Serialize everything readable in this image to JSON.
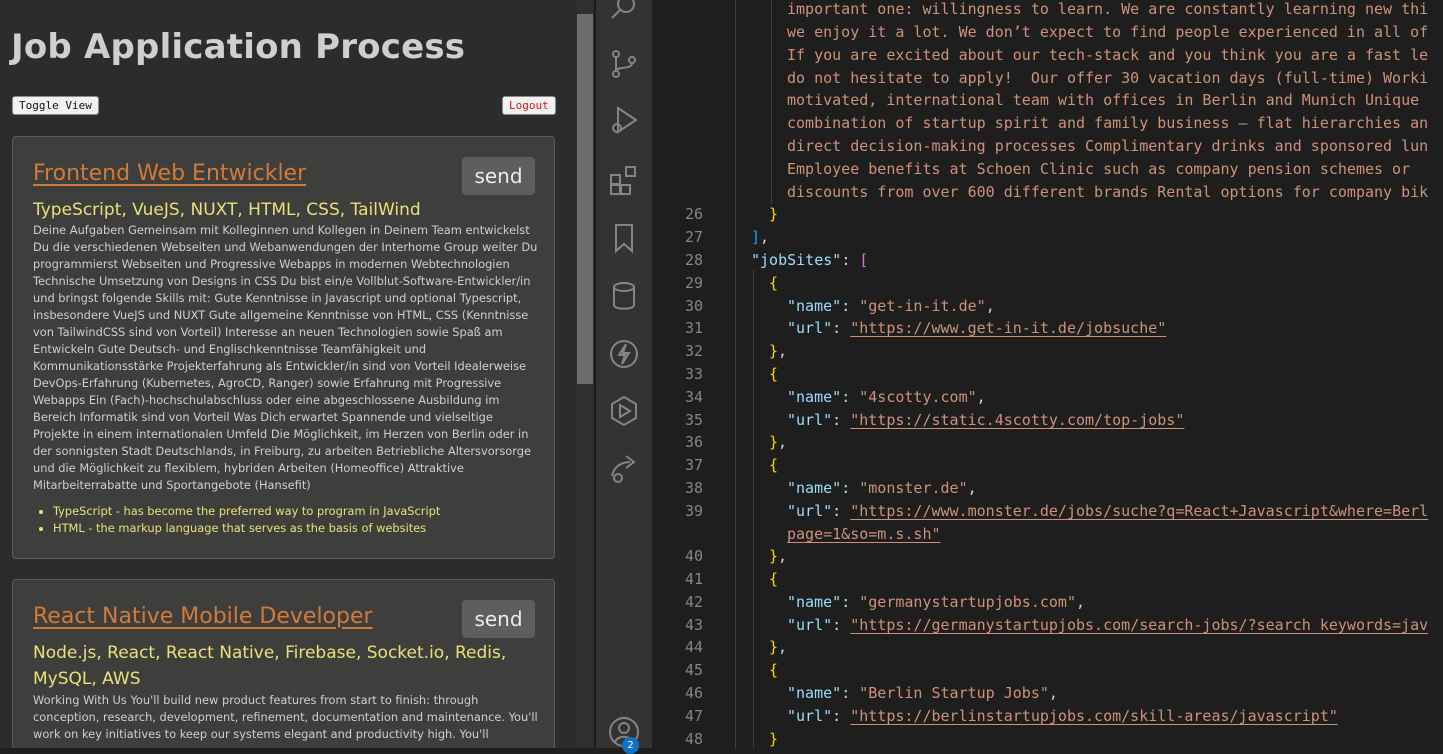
{
  "app": {
    "title": "Job Application Process",
    "toggle_label": "Toggle View",
    "logout_label": "Logout",
    "send_label": "send",
    "jobs": [
      {
        "title": "Frontend Web Entwickler",
        "stack": "TypeScript, VueJS, NUXT, HTML, CSS, TailWind",
        "description": "Deine Aufgaben Gemeinsam mit Kolleginnen und Kollegen in Deinem Team entwickelst Du die verschiedenen Webseiten und Webanwendungen der Interhome Group weiter Du programmierst Webseiten und Progressive Webapps in modernen Webtechnologien Technische Umsetzung von Designs in CSS Du bist ein/e Vollblut-Software-Entwickler/in und bringst folgende Skills mit: Gute Kenntnisse in Javascript und optional Typescript, insbesondere VueJS und NUXT Gute allgemeine Kenntnisse von HTML, CSS (Kenntnisse von TailwindCSS sind von Vorteil) Interesse an neuen Technologien sowie Spaß am Entwickeln Gute Deutsch- und Englischkenntnisse Teamfähigkeit und Kommunikationsstärke Projekterfahrung als Entwickler/in sind von Vorteil Idealerweise DevOps-Erfahrung (Kubernetes, AgroCD, Ranger) sowie Erfahrung mit Progressive Webapps Ein (Fach)-hochschulabschluss oder eine abgeschlossene Ausbildung im Bereich Informatik sind von Vorteil Was Dich erwartet Spannende und vielseitige Projekte in einem internationalen Umfeld Die Möglichkeit, im Herzen von Berlin oder in der sonnigsten Stadt Deutschlands, in Freiburg, zu arbeiten Betriebliche Altersvorsorge und die Möglichkeit zu flexiblem, hybriden Arbeiten (Homeoffice) Attraktive Mitarbeiterrabatte und Sportangebote (Hansefit)",
        "tech_notes": [
          "TypeScript - has become the preferred way to program in JavaScript",
          "HTML - the markup language that serves as the basis of websites"
        ]
      },
      {
        "title": "React Native Mobile Developer",
        "stack": "Node.js, React, React Native, Firebase, Socket.io, Redis, MySQL, AWS",
        "description": "Working With Us You'll build new product features from start to finish: through conception, research, development, refinement, documentation and maintenance. You'll work on key initiatives to keep our systems elegant and productivity high. You'll"
      }
    ]
  },
  "activity_bar": {
    "icons": [
      "search-icon",
      "source-control-icon",
      "run-debug-icon",
      "extensions-icon",
      "bookmark-icon",
      "database-icon",
      "lightning-icon",
      "deploy-icon",
      "remote-share-icon",
      "account-icon"
    ],
    "badge_count": "2",
    "badge_color": "#0e71c6"
  },
  "editor": {
    "wrapped_text": [
      "important one: willingness to learn. We are constantly learning new thi",
      "we enjoy it a lot. We don’t expect to find people experienced in all of",
      "If you are excited about our tech-stack and you think you are a fast le",
      "do not hesitate to apply!  Our offer 30 vacation days (full-time) Worki",
      "motivated, international team with offices in Berlin and Munich Unique",
      "combination of startup spirit and family business – flat hierarchies an",
      "direct decision-making processes Complimentary drinks and sponsored lun",
      "Employee benefits at Schoen Clinic such as company pension schemes or",
      "discounts from over 600 different brands Rental options for company bik"
    ],
    "line_numbers": [
      "26",
      "27",
      "28",
      "29",
      "30",
      "31",
      "32",
      "33",
      "34",
      "35",
      "36",
      "37",
      "38",
      "39",
      "40",
      "41",
      "42",
      "43",
      "44",
      "45",
      "46",
      "47",
      "48"
    ],
    "job_sites_key": "\"jobSites\"",
    "sites": [
      {
        "name": "\"get-in-it.de\"",
        "url": "\"https://www.get-in-it.de/jobsuche\""
      },
      {
        "name": "\"4scotty.com\"",
        "url": "\"https://static.4scotty.com/top-jobs\""
      },
      {
        "name": "\"monster.de\"",
        "url": "\"https://www.monster.de/jobs/suche?q=React+Javascript&where=Berl",
        "url_wrap": "page=1&so=m.s.sh\""
      },
      {
        "name": "\"germanystartupjobs.com\"",
        "url": "\"https://germanystartupjobs.com/search-jobs/?search_keywords=jav"
      },
      {
        "name": "\"Berlin Startup Jobs\"",
        "url": "\"https://berlinstartupjobs.com/skill-areas/javascript\""
      }
    ],
    "name_key": "\"name\"",
    "url_key": "\"url\"",
    "colors": {
      "string": "#ce9178",
      "key": "#9cdcfe",
      "line_number": "#858585"
    }
  }
}
